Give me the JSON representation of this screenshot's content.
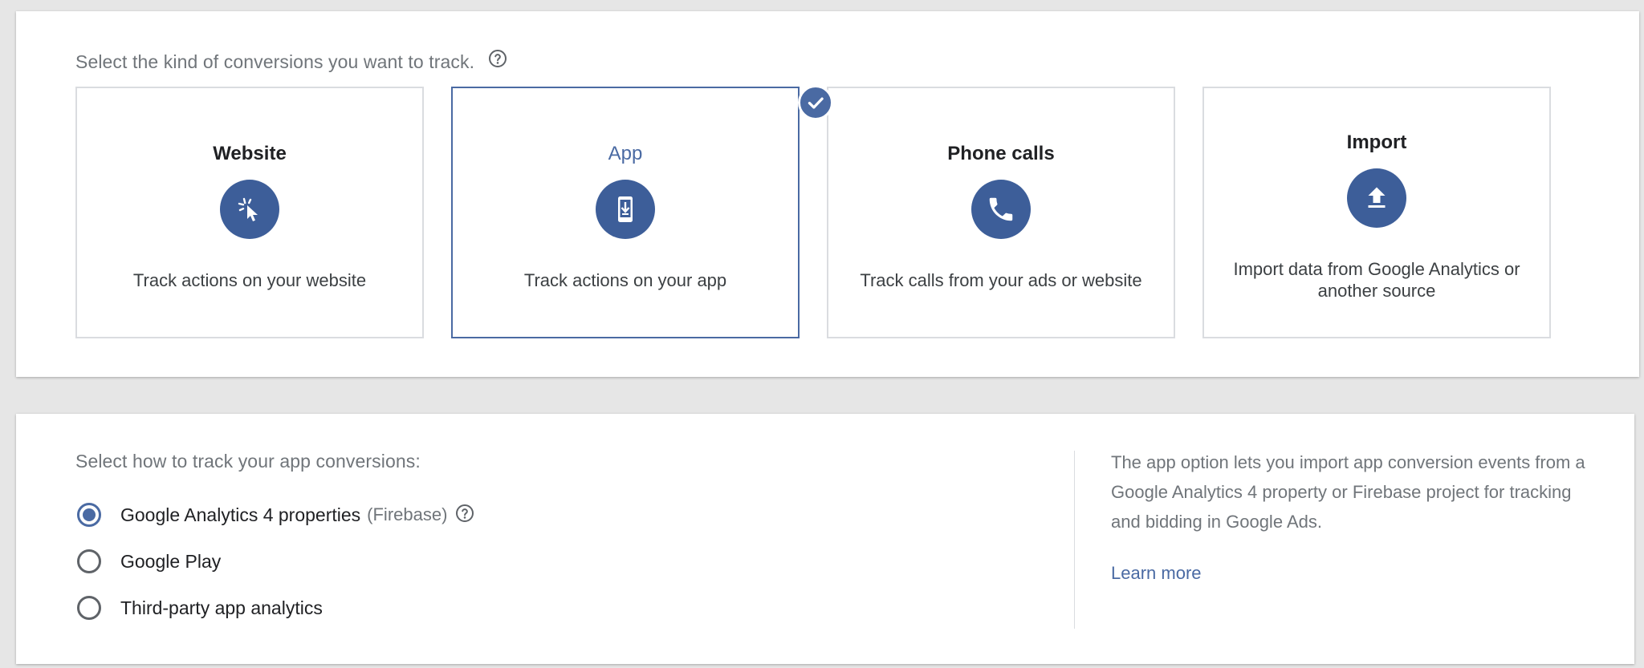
{
  "conversion_kind": {
    "prompt": "Select the kind of conversions you want to track.",
    "cards": [
      {
        "id": "website",
        "title": "Website",
        "icon": "cursor-click-icon",
        "description": "Track actions on your website",
        "selected": false
      },
      {
        "id": "app",
        "title": "App",
        "icon": "mobile-download-icon",
        "description": "Track actions on your app",
        "selected": true
      },
      {
        "id": "phone",
        "title": "Phone calls",
        "icon": "phone-icon",
        "description": "Track calls from your ads or website",
        "selected": false
      },
      {
        "id": "import",
        "title": "Import",
        "icon": "upload-icon",
        "description": "Import data from Google Analytics or another source",
        "selected": false
      }
    ]
  },
  "app_tracking": {
    "prompt": "Select how to track your app conversions:",
    "options": [
      {
        "label": "Google Analytics 4 properties",
        "sublabel": "(Firebase)",
        "checked": true
      },
      {
        "label": "Google Play",
        "checked": false
      },
      {
        "label": "Third-party app analytics",
        "checked": false
      }
    ],
    "info_text": "The app option lets you import app conversion events from a Google Analytics 4 property or Firebase project for tracking and bidding in Google Ads.",
    "learn_more": "Learn more"
  },
  "colors": {
    "accent": "#4a6aa3",
    "icon_bg": "#3d5e99",
    "border": "#dadce0"
  }
}
